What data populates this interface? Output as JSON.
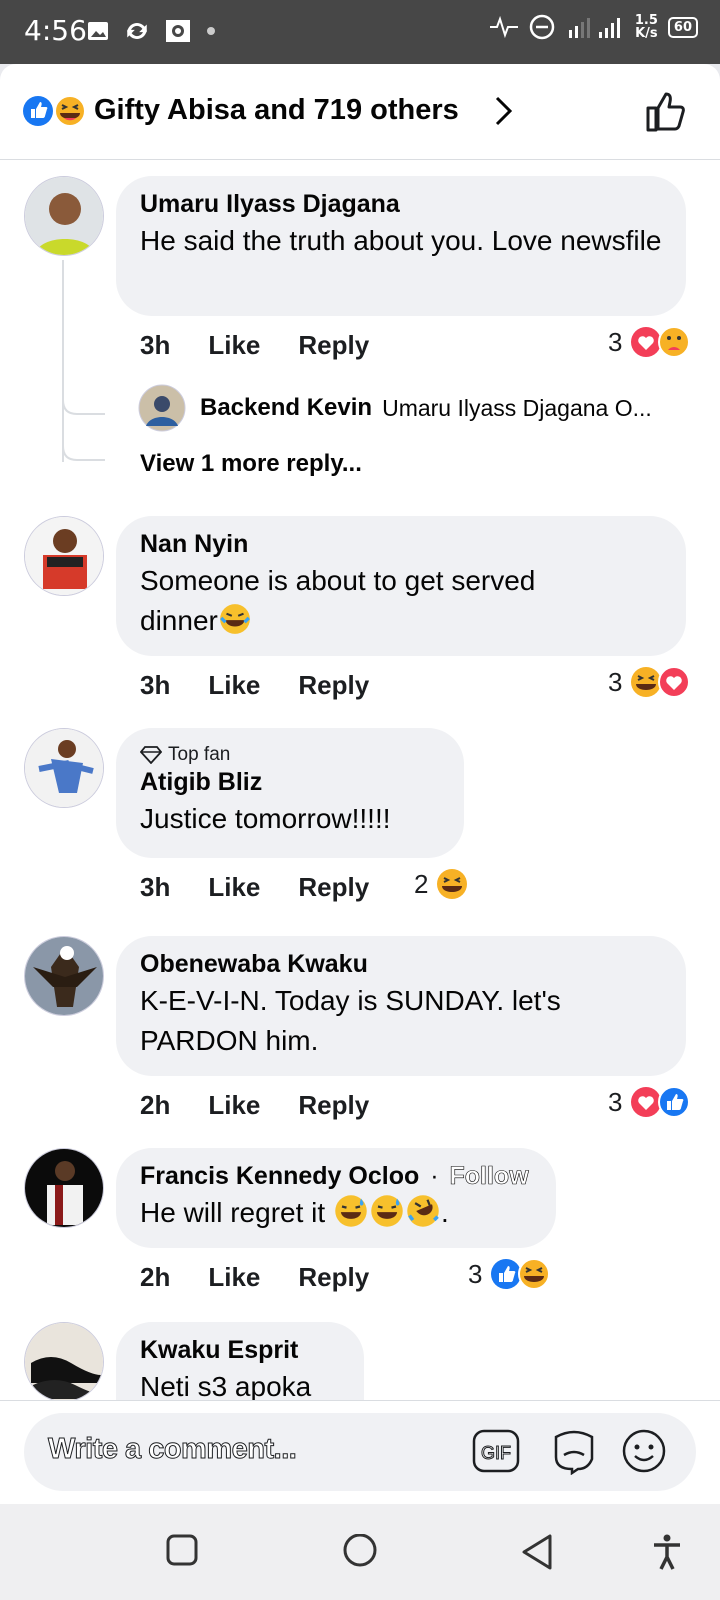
{
  "status_bar": {
    "time": "4:56",
    "speed_value": "1.5",
    "speed_unit": "K/s",
    "battery": "60"
  },
  "header": {
    "title": "Gifty Abisa and 719 others"
  },
  "comments": [
    {
      "author": "Umaru Ilyass Djagana",
      "text": "He said the truth about you. Love newsfile",
      "time": "3h",
      "like": "Like",
      "reply": "Reply",
      "reaction_count": "3",
      "reply_preview": {
        "author": "Backend Kevin",
        "text": "Umaru Ilyass Djagana O..."
      },
      "more_replies": "View 1 more reply..."
    },
    {
      "author": "Nan Nyin",
      "text": "Someone is about to get served dinner",
      "time": "3h",
      "like": "Like",
      "reply": "Reply",
      "reaction_count": "3"
    },
    {
      "badge": "Top fan",
      "author": "Atigib Bliz",
      "text": "Justice tomorrow!!!!!",
      "time": "3h",
      "like": "Like",
      "reply": "Reply",
      "reaction_count": "2"
    },
    {
      "author": "Obenewaba Kwaku",
      "text": "K-E-V-I-N. Today is SUNDAY. let's PARDON him.",
      "time": "2h",
      "like": "Like",
      "reply": "Reply",
      "reaction_count": "3"
    },
    {
      "author": "Francis Kennedy Ocloo",
      "follow_sep": "·",
      "follow": "Follow",
      "text": "He will regret it",
      "text_end": ".",
      "time": "2h",
      "like": "Like",
      "reply": "Reply",
      "reaction_count": "3"
    },
    {
      "author": "Kwaku Esprit",
      "text": "Neti s3 apoka"
    }
  ],
  "composer": {
    "placeholder": "Write a comment...",
    "gif": "GIF"
  },
  "icons": [
    "image-icon",
    "sync-icon",
    "photo-icon",
    "dot-icon",
    "activity-icon",
    "dnd-icon",
    "signal-icon",
    "like-reaction-icon",
    "haha-reaction-icon",
    "love-reaction-icon",
    "care-reaction-icon",
    "chevron-right-icon",
    "thumbs-up-icon",
    "diamond-icon",
    "gif-icon",
    "sticker-icon",
    "emoji-icon",
    "square-icon",
    "circle-icon",
    "back-icon",
    "accessibility-icon"
  ],
  "colors": {
    "like_blue": "#1877f2",
    "love_red": "#f33e58",
    "haha_yellow": "#f7b125",
    "bubble": "#f0f1f4"
  }
}
